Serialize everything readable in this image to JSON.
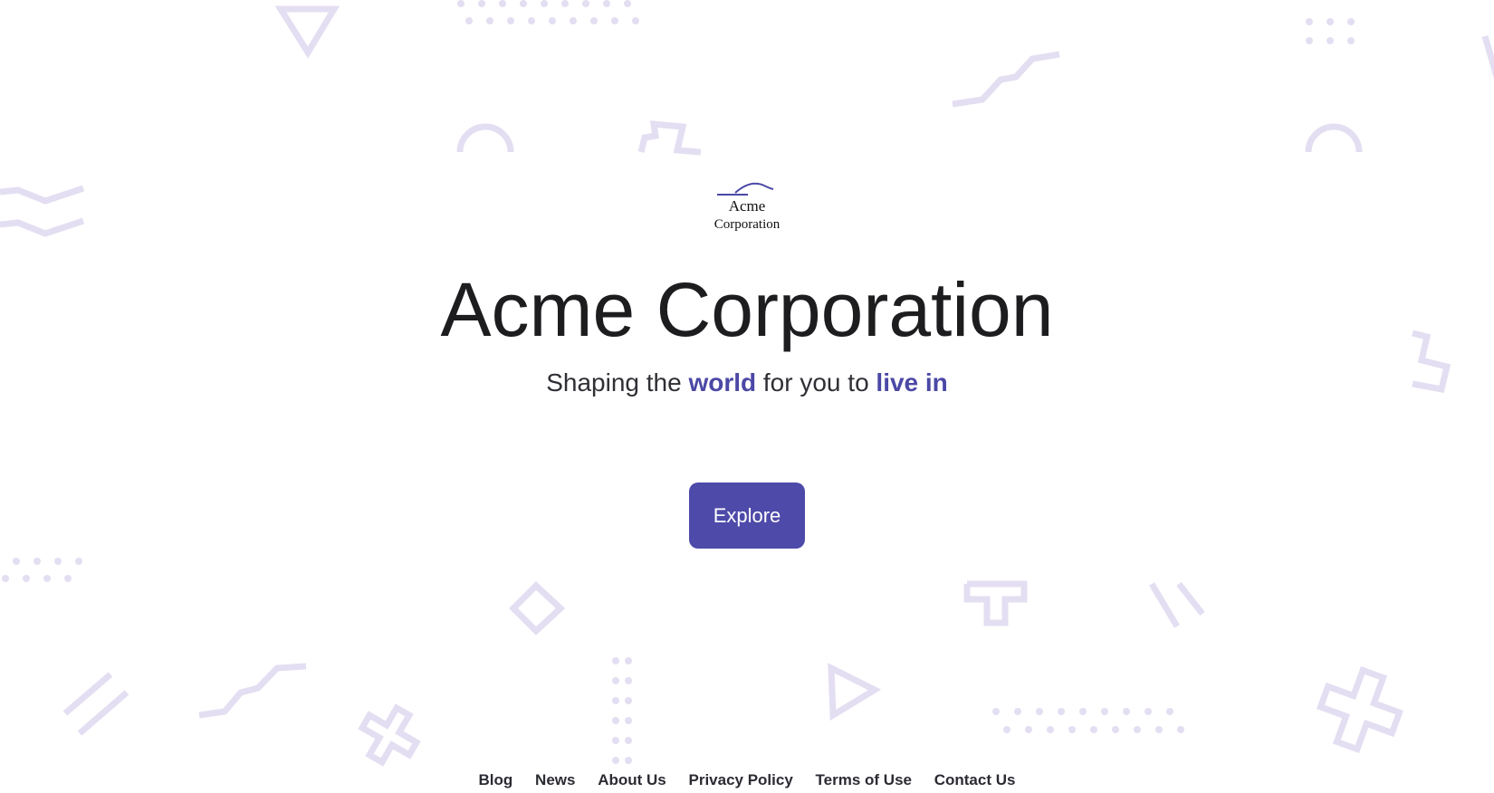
{
  "logo": {
    "line1": "Acme",
    "line2": "Corporation"
  },
  "hero": {
    "title": "Acme Corporation",
    "subtitle_part1": "Shaping the ",
    "subtitle_highlight1": "world",
    "subtitle_part2": " for you to ",
    "subtitle_highlight2": "live in",
    "button_label": "Explore"
  },
  "footer": {
    "links": [
      "Blog",
      "News",
      "About Us",
      "Privacy Policy",
      "Terms of Use",
      "Contact Us"
    ]
  },
  "colors": {
    "accent": "#4e4aa9",
    "decor": "#e4def2",
    "text": "#1d1d1f"
  }
}
